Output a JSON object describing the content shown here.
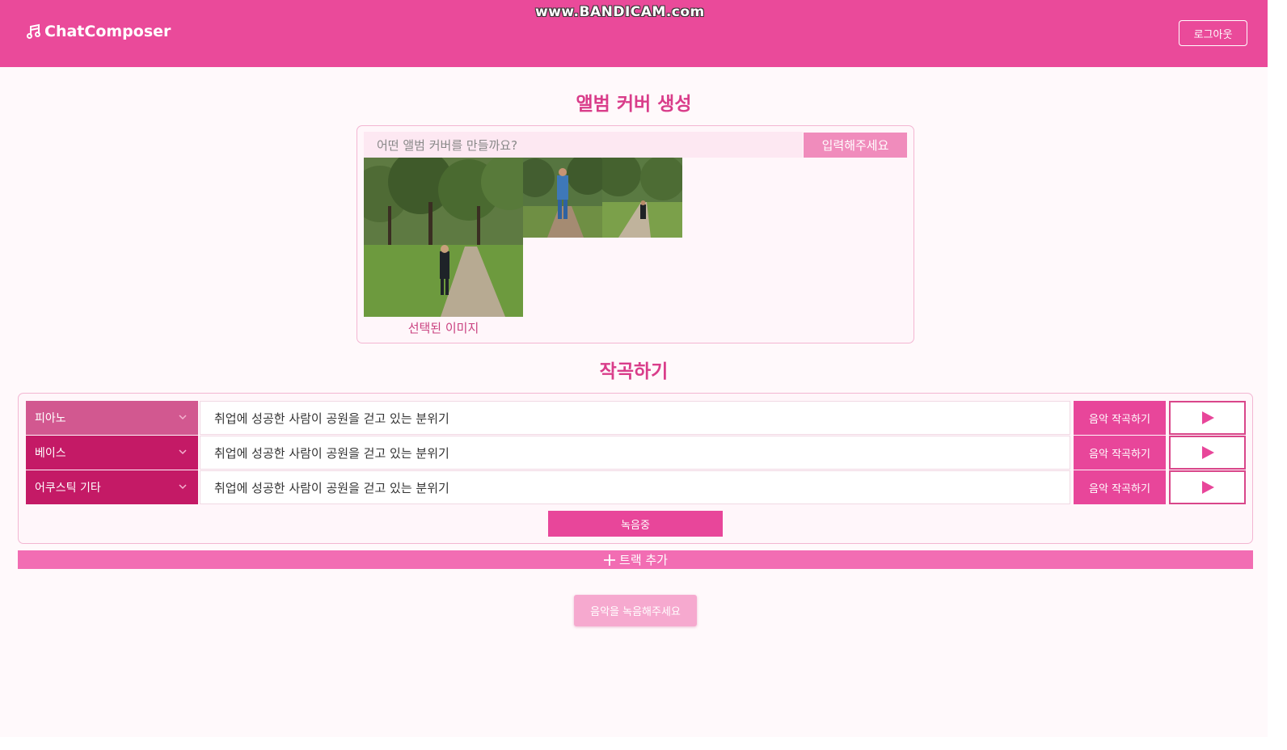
{
  "header": {
    "logo_text": "ChatComposer",
    "logout_label": "로그아웃",
    "watermark": "www.BANDICAM.com"
  },
  "album": {
    "title": "앨범 커버 생성",
    "input_placeholder": "어떤 앨범 커버를 만들까요?",
    "submit_label": "입력해주세요",
    "selected_label": "선택된 이미지"
  },
  "compose": {
    "title": "작곡하기",
    "tracks": [
      {
        "instrument": "피아노",
        "prompt": "취업에 성공한 사람이 공원을 걷고 있는 분위기",
        "compose_label": "음악 작곡하기",
        "color": "#d25890"
      },
      {
        "instrument": "베이스",
        "prompt": "취업에 성공한 사람이 공원을 걷고 있는 분위기",
        "compose_label": "음악 작곡하기",
        "color": "#c41a66"
      },
      {
        "instrument": "어쿠스틱 기타",
        "prompt": "취업에 성공한 사람이 공원을 걷고 있는 분위기",
        "compose_label": "음악 작곡하기",
        "color": "#c41a66"
      }
    ],
    "recording_label": "녹음중",
    "add_track_label": "트랙 추가",
    "record_request_label": "음악을 녹음해주세요"
  },
  "colors": {
    "brand": "#ea4a9a",
    "accent": "#e8469a",
    "title": "#d93d8a"
  }
}
